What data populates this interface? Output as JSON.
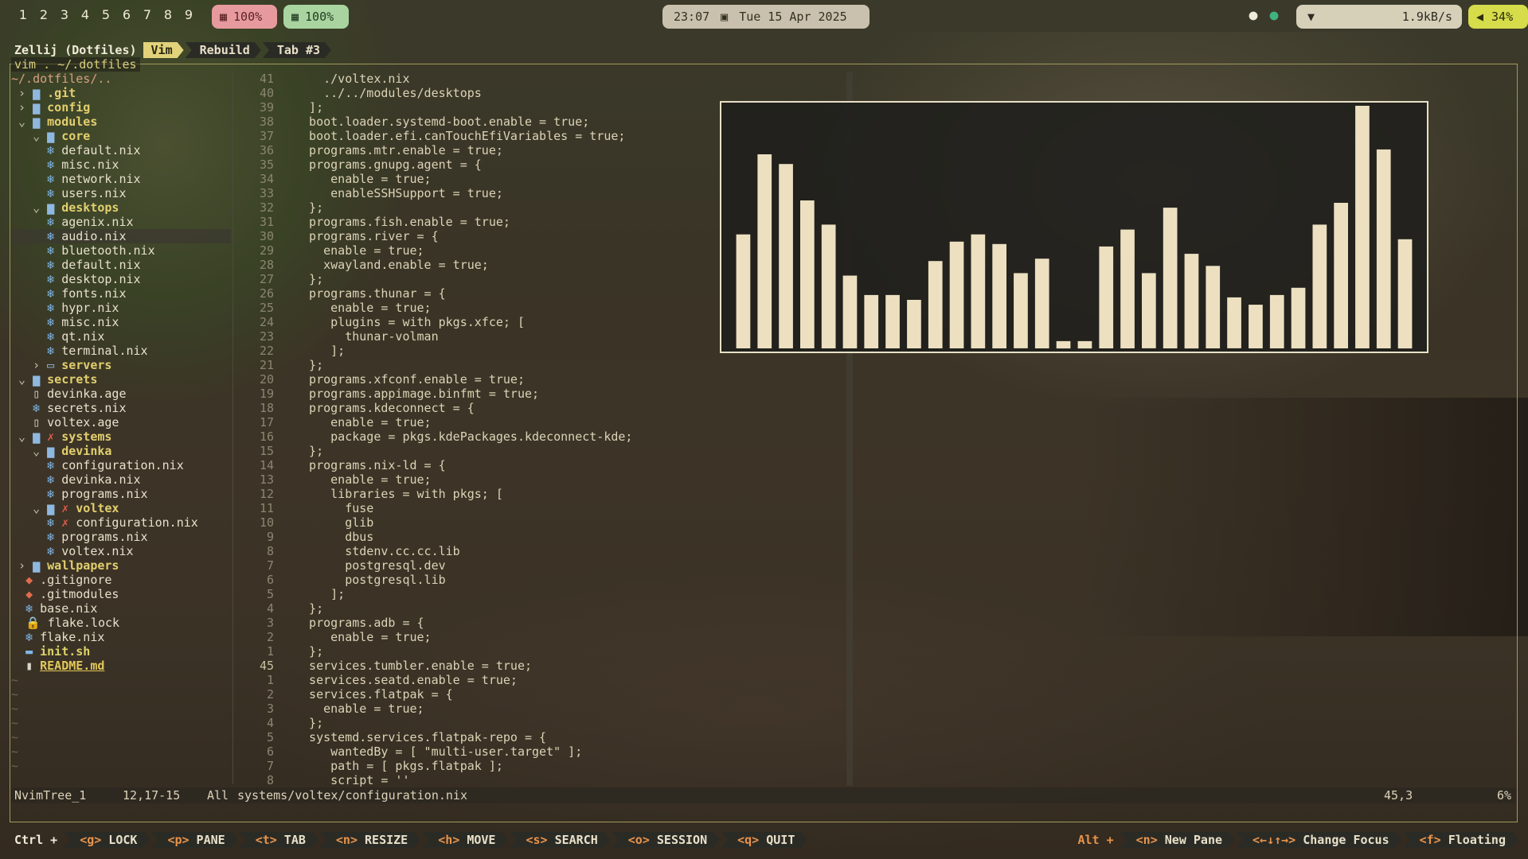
{
  "topbar": {
    "workspaces": [
      "1",
      "2",
      "3",
      "4",
      "5",
      "6",
      "7",
      "8",
      "9"
    ],
    "memory": "100%",
    "cpu": "100%",
    "time": "23:07",
    "date": "Tue 15  Apr 2025",
    "network": "1.9kB/s",
    "volume": "34%"
  },
  "tabbar": {
    "session": "Zellij (Dotfiles)",
    "tabs": [
      "Vim",
      "Rebuild",
      "Tab #3"
    ]
  },
  "pane_title": "vim . ~/.dotfiles",
  "tree": [
    {
      "indent": "",
      "arrow": "",
      "icon": "",
      "name": "~/.dotfiles/..",
      "kind": "root"
    },
    {
      "indent": " ",
      "arrow": "›",
      "icon": "▆",
      "name": ".git",
      "kind": "dir"
    },
    {
      "indent": " ",
      "arrow": "›",
      "icon": "▆",
      "name": "config",
      "kind": "dir"
    },
    {
      "indent": " ",
      "arrow": "⌄",
      "icon": "▆",
      "name": "modules",
      "kind": "dir"
    },
    {
      "indent": "   ",
      "arrow": "⌄",
      "icon": "▆",
      "name": "core",
      "kind": "dir"
    },
    {
      "indent": "     ",
      "arrow": "",
      "icon": "❄",
      "name": "default.nix",
      "kind": "nix"
    },
    {
      "indent": "     ",
      "arrow": "",
      "icon": "❄",
      "name": "misc.nix",
      "kind": "nix"
    },
    {
      "indent": "     ",
      "arrow": "",
      "icon": "❄",
      "name": "network.nix",
      "kind": "nix"
    },
    {
      "indent": "     ",
      "arrow": "",
      "icon": "❄",
      "name": "users.nix",
      "kind": "nix"
    },
    {
      "indent": "   ",
      "arrow": "⌄",
      "icon": "▆",
      "name": "desktops",
      "kind": "dir"
    },
    {
      "indent": "     ",
      "arrow": "",
      "icon": "❄",
      "name": "agenix.nix",
      "kind": "nix"
    },
    {
      "indent": "     ",
      "arrow": "",
      "icon": "❄",
      "name": "audio.nix",
      "kind": "nix",
      "hl": true
    },
    {
      "indent": "     ",
      "arrow": "",
      "icon": "❄",
      "name": "bluetooth.nix",
      "kind": "nix"
    },
    {
      "indent": "     ",
      "arrow": "",
      "icon": "❄",
      "name": "default.nix",
      "kind": "nix"
    },
    {
      "indent": "     ",
      "arrow": "",
      "icon": "❄",
      "name": "desktop.nix",
      "kind": "nix"
    },
    {
      "indent": "     ",
      "arrow": "",
      "icon": "❄",
      "name": "fonts.nix",
      "kind": "nix"
    },
    {
      "indent": "     ",
      "arrow": "",
      "icon": "❄",
      "name": "hypr.nix",
      "kind": "nix"
    },
    {
      "indent": "     ",
      "arrow": "",
      "icon": "❄",
      "name": "misc.nix",
      "kind": "nix"
    },
    {
      "indent": "     ",
      "arrow": "",
      "icon": "❄",
      "name": "qt.nix",
      "kind": "nix"
    },
    {
      "indent": "     ",
      "arrow": "",
      "icon": "❄",
      "name": "terminal.nix",
      "kind": "nix"
    },
    {
      "indent": "   ",
      "arrow": "›",
      "icon": "▭",
      "name": "servers",
      "kind": "dir"
    },
    {
      "indent": " ",
      "arrow": "⌄",
      "icon": "▆",
      "name": "secrets",
      "kind": "dir"
    },
    {
      "indent": "   ",
      "arrow": "",
      "icon": "▯",
      "name": "devinka.age",
      "kind": "file"
    },
    {
      "indent": "   ",
      "arrow": "",
      "icon": "❄",
      "name": "secrets.nix",
      "kind": "nix"
    },
    {
      "indent": "   ",
      "arrow": "",
      "icon": "▯",
      "name": "voltex.age",
      "kind": "file"
    },
    {
      "indent": " ",
      "arrow": "⌄",
      "icon": "▆ ✗",
      "name": "systems",
      "kind": "dir-x"
    },
    {
      "indent": "   ",
      "arrow": "⌄",
      "icon": "▆",
      "name": "devinka",
      "kind": "dir"
    },
    {
      "indent": "     ",
      "arrow": "",
      "icon": "❄",
      "name": "configuration.nix",
      "kind": "nix"
    },
    {
      "indent": "     ",
      "arrow": "",
      "icon": "❄",
      "name": "devinka.nix",
      "kind": "nix"
    },
    {
      "indent": "     ",
      "arrow": "",
      "icon": "❄",
      "name": "programs.nix",
      "kind": "nix"
    },
    {
      "indent": "   ",
      "arrow": "⌄",
      "icon": "▆ ✗",
      "name": "voltex",
      "kind": "dir-x"
    },
    {
      "indent": "     ",
      "arrow": "",
      "icon": "❄ ✗",
      "name": "configuration.nix",
      "kind": "nix-x"
    },
    {
      "indent": "     ",
      "arrow": "",
      "icon": "❄",
      "name": "programs.nix",
      "kind": "nix"
    },
    {
      "indent": "     ",
      "arrow": "",
      "icon": "❄",
      "name": "voltex.nix",
      "kind": "nix"
    },
    {
      "indent": " ",
      "arrow": "›",
      "icon": "▆",
      "name": "wallpapers",
      "kind": "dir"
    },
    {
      "indent": "  ",
      "arrow": "",
      "icon": "◆",
      "name": ".gitignore",
      "kind": "git"
    },
    {
      "indent": "  ",
      "arrow": "",
      "icon": "◆",
      "name": ".gitmodules",
      "kind": "git"
    },
    {
      "indent": "  ",
      "arrow": "",
      "icon": "❄",
      "name": "base.nix",
      "kind": "nix"
    },
    {
      "indent": "  ",
      "arrow": "",
      "icon": "🔒",
      "name": "flake.lock",
      "kind": "lock"
    },
    {
      "indent": "  ",
      "arrow": "",
      "icon": "❄",
      "name": "flake.nix",
      "kind": "nix"
    },
    {
      "indent": "  ",
      "arrow": "",
      "icon": "▬",
      "name": "init.sh",
      "kind": "exe"
    },
    {
      "indent": "  ",
      "arrow": "",
      "icon": "▮",
      "name": "README.md",
      "kind": "bold"
    }
  ],
  "code": [
    {
      "n": "41",
      "t": "    ./voltex.nix"
    },
    {
      "n": "40",
      "t": "    ../../modules/desktops"
    },
    {
      "n": "39",
      "t": "  ];"
    },
    {
      "n": "38",
      "t": "  boot.loader.systemd-boot.enable = true;"
    },
    {
      "n": "37",
      "t": "  boot.loader.efi.canTouchEfiVariables = true;"
    },
    {
      "n": "36",
      "t": "  programs.mtr.enable = true;"
    },
    {
      "n": "35",
      "t": "  programs.gnupg.agent = {"
    },
    {
      "n": "34",
      "t": "     enable = true;"
    },
    {
      "n": "33",
      "t": "     enableSSHSupport = true;"
    },
    {
      "n": "32",
      "t": "  };"
    },
    {
      "n": "31",
      "t": "  programs.fish.enable = true;"
    },
    {
      "n": "30",
      "t": "  programs.river = {"
    },
    {
      "n": "29",
      "t": "    enable = true;"
    },
    {
      "n": "28",
      "t": "    xwayland.enable = true;"
    },
    {
      "n": "27",
      "t": "  };"
    },
    {
      "n": "26",
      "t": "  programs.thunar = {"
    },
    {
      "n": "25",
      "t": "     enable = true;"
    },
    {
      "n": "24",
      "t": "     plugins = with pkgs.xfce; ["
    },
    {
      "n": "23",
      "t": "       thunar-volman"
    },
    {
      "n": "22",
      "t": "     ];"
    },
    {
      "n": "21",
      "t": "  };"
    },
    {
      "n": "20",
      "t": "  programs.xfconf.enable = true;"
    },
    {
      "n": "19",
      "t": "  programs.appimage.binfmt = true;"
    },
    {
      "n": "18",
      "t": "  programs.kdeconnect = {"
    },
    {
      "n": "17",
      "t": "     enable = true;"
    },
    {
      "n": "16",
      "t": "     package = pkgs.kdePackages.kdeconnect-kde;"
    },
    {
      "n": "15",
      "t": "  };"
    },
    {
      "n": "14",
      "t": "  programs.nix-ld = {"
    },
    {
      "n": "13",
      "t": "     enable = true;"
    },
    {
      "n": "12",
      "t": "     libraries = with pkgs; ["
    },
    {
      "n": "11",
      "t": "       fuse"
    },
    {
      "n": "10",
      "t": "       glib"
    },
    {
      "n": "9",
      "t": "       dbus"
    },
    {
      "n": "8",
      "t": "       stdenv.cc.cc.lib"
    },
    {
      "n": "7",
      "t": "       postgresql.dev"
    },
    {
      "n": "6",
      "t": "       postgresql.lib"
    },
    {
      "n": "5",
      "t": "     ];"
    },
    {
      "n": "4",
      "t": "  };"
    },
    {
      "n": "3",
      "t": "  programs.adb = {"
    },
    {
      "n": "2",
      "t": "     enable = true;"
    },
    {
      "n": "1",
      "t": "  };"
    },
    {
      "n": "45",
      "t": "  services.tumbler.enable = true;",
      "cur": true
    },
    {
      "n": "1",
      "t": "  services.seatd.enable = true;"
    },
    {
      "n": "2",
      "t": "  services.flatpak = {"
    },
    {
      "n": "3",
      "t": "    enable = true;"
    },
    {
      "n": "4",
      "t": "  };"
    },
    {
      "n": "5",
      "t": "  systemd.services.flatpak-repo = {"
    },
    {
      "n": "6",
      "t": "     wantedBy = [ \"multi-user.target\" ];"
    },
    {
      "n": "7",
      "t": "     path = [ pkgs.flatpak ];"
    },
    {
      "n": "8",
      "t": "     script = ''"
    }
  ],
  "visualizer": {
    "color": "#ece0c0",
    "levels": [
      0.47,
      0.8,
      0.76,
      0.61,
      0.51,
      0.3,
      0.22,
      0.22,
      0.2,
      0.36,
      0.44,
      0.47,
      0.43,
      0.31,
      0.37,
      0.03,
      0.03,
      0.42,
      0.49,
      0.31,
      0.58,
      0.39,
      0.34,
      0.21,
      0.18,
      0.22,
      0.25,
      0.51,
      0.6,
      1.0,
      0.82,
      0.45
    ]
  },
  "statusline": {
    "buffer": "NvimTree_1",
    "position": "12,17-15",
    "scope": "All",
    "file": "systems/voltex/configuration.nix",
    "cursor": "45,3",
    "percent": "6%"
  },
  "bottombar": {
    "ctrl_label": "Ctrl +",
    "keys": [
      {
        "k": "<g>",
        "l": "LOCK"
      },
      {
        "k": "<p>",
        "l": "PANE"
      },
      {
        "k": "<t>",
        "l": "TAB"
      },
      {
        "k": "<n>",
        "l": "RESIZE"
      },
      {
        "k": "<h>",
        "l": "MOVE"
      },
      {
        "k": "<s>",
        "l": "SEARCH"
      },
      {
        "k": "<o>",
        "l": "SESSION"
      },
      {
        "k": "<q>",
        "l": "QUIT"
      }
    ],
    "alt_label": "Alt +",
    "alt_keys": [
      {
        "k": "<n>",
        "l": "New Pane"
      },
      {
        "k": "<←↓↑→>",
        "l": "Change Focus"
      },
      {
        "k": "<f>",
        "l": "Floating"
      }
    ]
  }
}
